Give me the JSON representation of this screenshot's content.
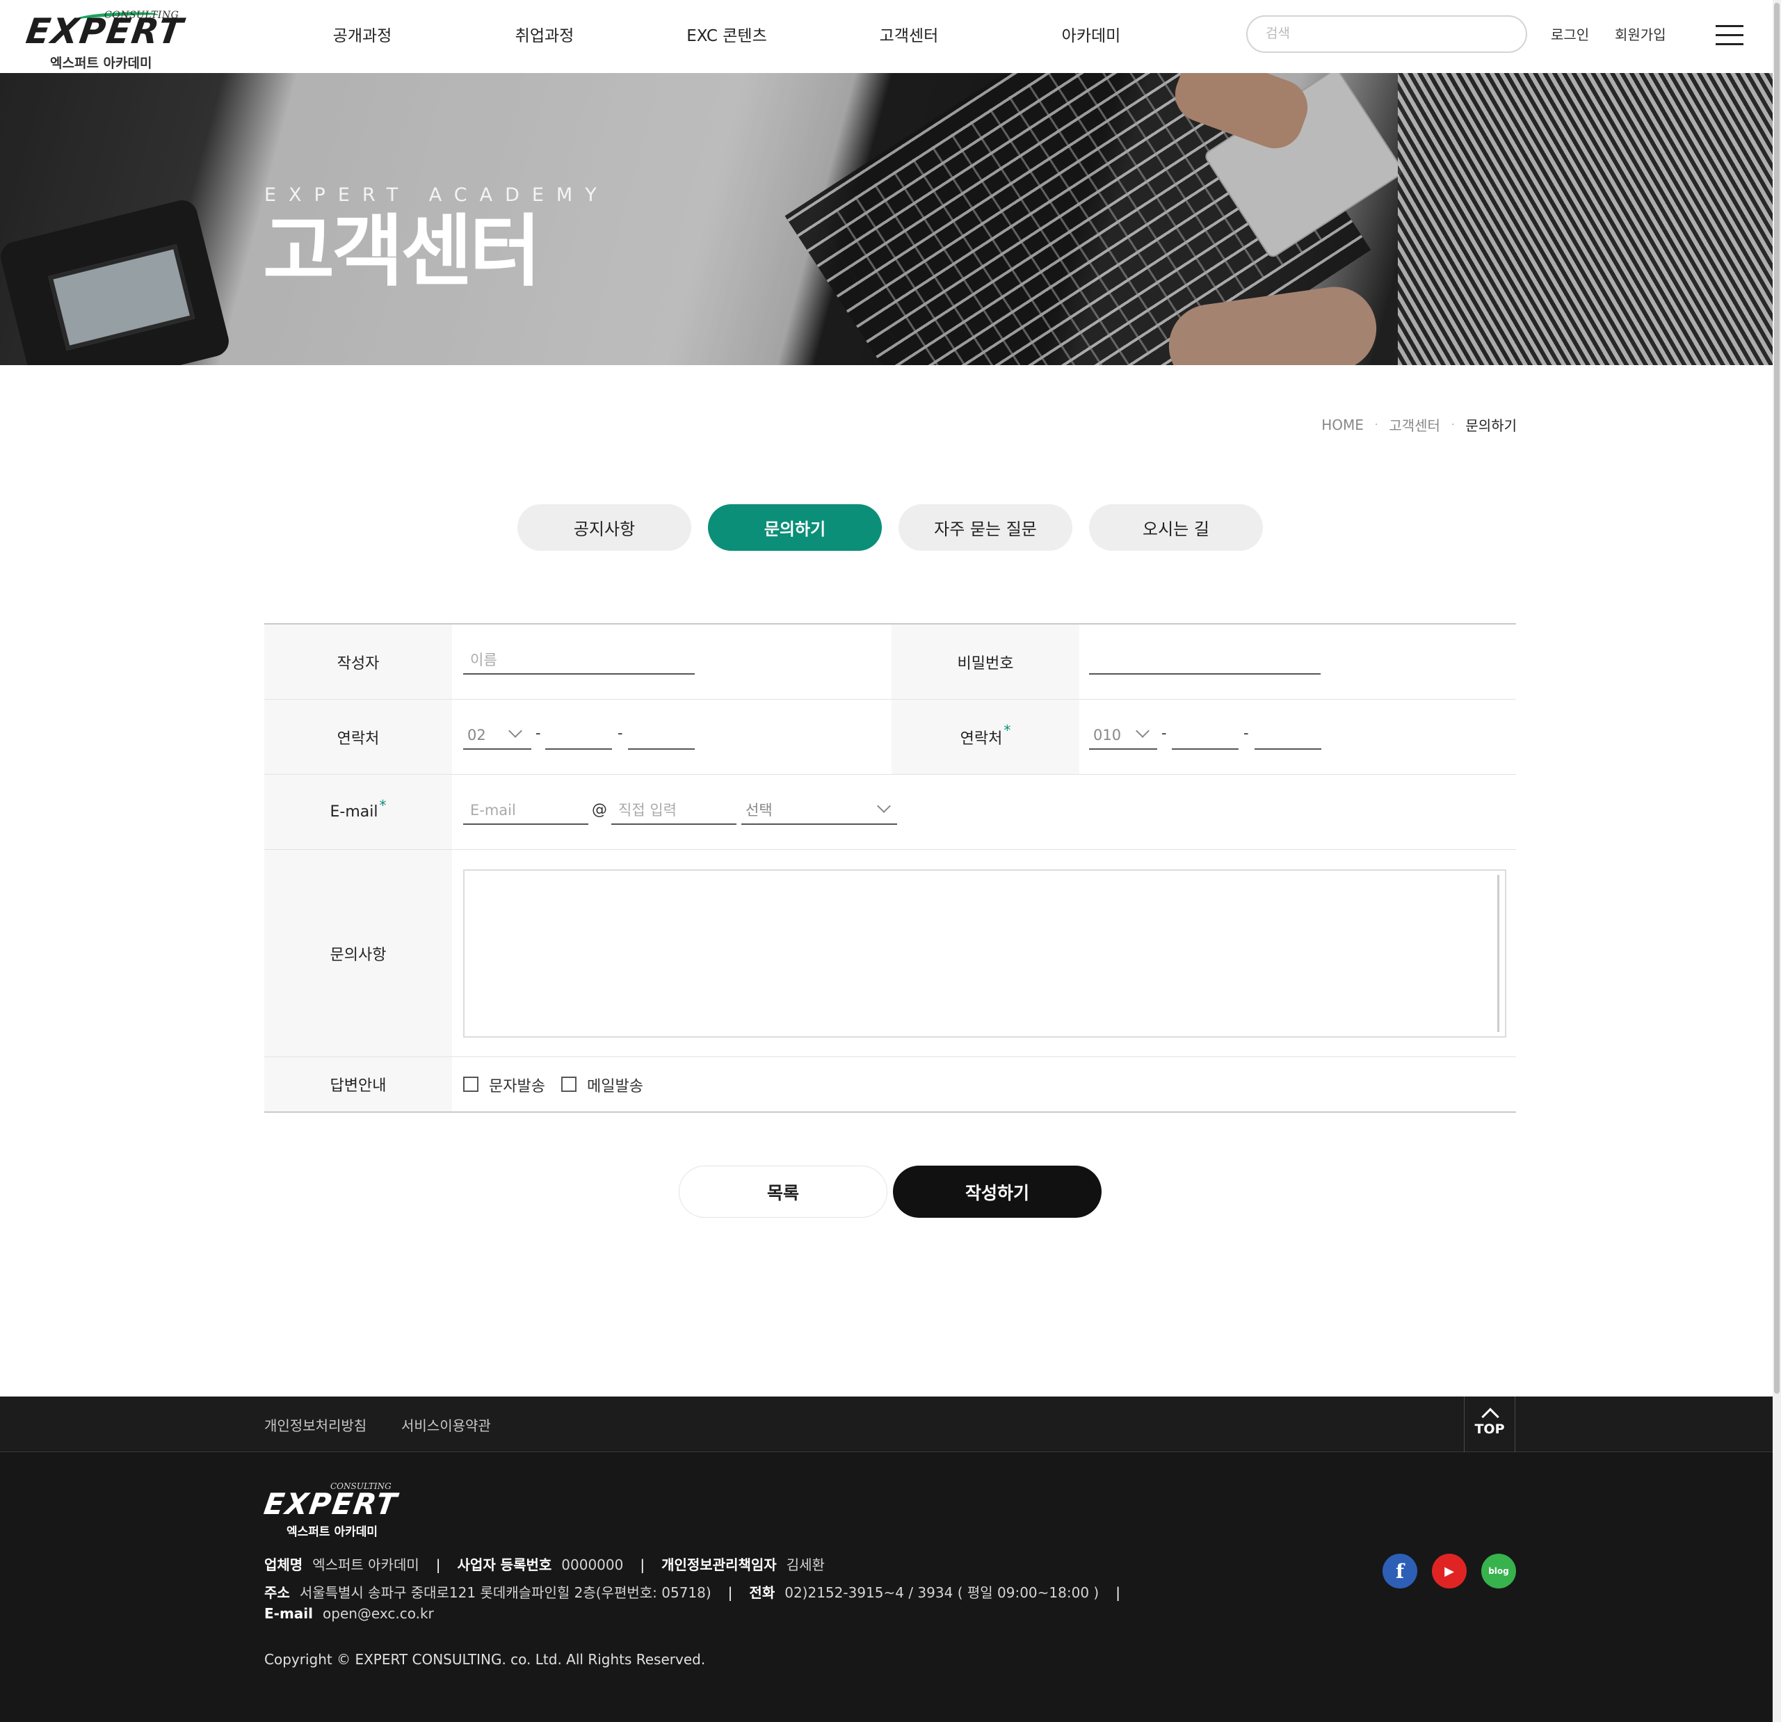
{
  "header": {
    "logo_top": "CONSULTING",
    "logo_main": "EXPERT",
    "logo_sub": "엑스퍼트 아카데미",
    "nav": [
      "공개과정",
      "취업과정",
      "EXC 콘텐츠",
      "고객센터",
      "아카데미"
    ],
    "search_placeholder": "검색",
    "login": "로그인",
    "signup": "회원가입",
    "menu_icon": "hamburger-menu-icon"
  },
  "hero": {
    "subtitle": "EXPERT ACADEMY",
    "title": "고객센터"
  },
  "breadcrumb": {
    "home": "HOME",
    "level1": "고객센터",
    "current": "문의하기",
    "separator": "·"
  },
  "tabs": [
    {
      "label": "공지사항",
      "active": false
    },
    {
      "label": "문의하기",
      "active": true
    },
    {
      "label": "자주 묻는 질문",
      "active": false
    },
    {
      "label": "오시는 길",
      "active": false
    }
  ],
  "form": {
    "author_label": "작성자",
    "author_placeholder": "이름",
    "password_label": "비밀번호",
    "phone_label": "연락처",
    "phone_prefix": "02",
    "mobile_label": "연락처",
    "mobile_prefix": "010",
    "required_mark": "*",
    "dash": "-",
    "email_label": "E-mail",
    "email_placeholder": "E-mail",
    "at": "@",
    "domain_placeholder": "직접 입력",
    "domain_select": "선택",
    "inquiry_label": "문의사항",
    "reply_label": "답변안내",
    "reply_sms": "문자발송",
    "reply_mail": "메일발송"
  },
  "buttons": {
    "list": "목록",
    "submit": "작성하기"
  },
  "footer": {
    "links": [
      "개인정보처리방침",
      "서비스이용약관"
    ],
    "top": "TOP",
    "logo_top": "CONSULTING",
    "logo_main": "EXPERT",
    "logo_sub": "엑스퍼트 아카데미",
    "company_label": "업체명",
    "company": "엑스퍼트 아카데미",
    "biz_label": "사업자 등록번호",
    "biz": "0000000",
    "privacy_label": "개인정보관리책임자",
    "privacy": "김세환",
    "address_label": "주소",
    "address": "서울특별시 송파구 중대로121 롯데캐슬파인힐 2층(우편번호: 05718)",
    "tel_label": "전화",
    "tel": "02)2152-3915~4 / 3934 ( 평일 09:00~18:00 )",
    "bar": "|",
    "email_label": "E-mail",
    "email": "open@exc.co.kr",
    "copyright": "Copyright © EXPERT CONSULTING. co. Ltd. All Rights Reserved.",
    "social": [
      {
        "name": "facebook",
        "glyph": "f",
        "color": "#2d5fb7"
      },
      {
        "name": "youtube",
        "glyph": "▶",
        "color": "#e02424"
      },
      {
        "name": "blog",
        "glyph": "blog",
        "color": "#37b24d"
      }
    ]
  },
  "colors": {
    "accent": "#0b8f78",
    "dark": "#111111",
    "footer_bg": "#171717"
  }
}
